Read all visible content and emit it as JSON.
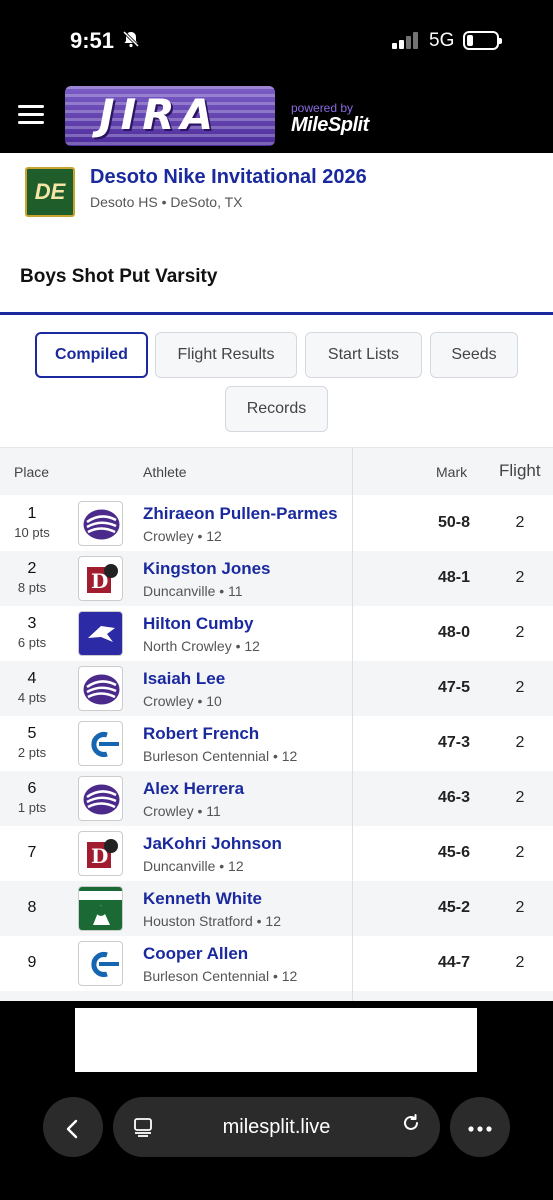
{
  "status_bar": {
    "time": "9:51",
    "network": "5G",
    "bell_icon": "bell-slash-icon"
  },
  "header": {
    "logo_text": "JIRA",
    "powered_by": "powered by",
    "brand": "MileSplit",
    "accent_color": "#5b3bb0"
  },
  "meet": {
    "logo_text": "DE",
    "title": "Desoto Nike Invitational 2026",
    "location": "Desoto HS • DeSoto, TX"
  },
  "event": {
    "title": "Boys Shot Put Varsity"
  },
  "tabs": [
    {
      "label": "Compiled",
      "active": true
    },
    {
      "label": "Flight Results",
      "active": false
    },
    {
      "label": "Start Lists",
      "active": false
    },
    {
      "label": "Seeds",
      "active": false
    },
    {
      "label": "Records",
      "active": false
    }
  ],
  "table": {
    "headers": {
      "place": "Place",
      "athlete": "Athlete",
      "mark": "Mark",
      "flight": "Flight"
    },
    "rows": [
      {
        "place": "1",
        "pts": "10 pts",
        "name": "Zhiraeon Pullen-Parmes",
        "team": "Crowley • 12",
        "logo": "crowley",
        "mark": "50-8",
        "flight": "2"
      },
      {
        "place": "2",
        "pts": "8 pts",
        "name": "Kingston Jones",
        "team": "Duncanville • 11",
        "logo": "duncanville",
        "mark": "48-1",
        "flight": "2"
      },
      {
        "place": "3",
        "pts": "6 pts",
        "name": "Hilton Cumby",
        "team": "North Crowley • 12",
        "logo": "north-crowley",
        "mark": "48-0",
        "flight": "2"
      },
      {
        "place": "4",
        "pts": "4 pts",
        "name": "Isaiah Lee",
        "team": "Crowley • 10",
        "logo": "crowley",
        "mark": "47-5",
        "flight": "2"
      },
      {
        "place": "5",
        "pts": "2 pts",
        "name": "Robert French",
        "team": "Burleson Centennial • 12",
        "logo": "burleson",
        "mark": "47-3",
        "flight": "2"
      },
      {
        "place": "6",
        "pts": "1 pts",
        "name": "Alex Herrera",
        "team": "Crowley • 11",
        "logo": "crowley",
        "mark": "46-3",
        "flight": "2"
      },
      {
        "place": "7",
        "pts": "",
        "name": "JaKohri Johnson",
        "team": "Duncanville • 12",
        "logo": "duncanville",
        "mark": "45-6",
        "flight": "2"
      },
      {
        "place": "8",
        "pts": "",
        "name": "Kenneth White",
        "team": "Houston Stratford • 12",
        "logo": "stratford",
        "mark": "45-2",
        "flight": "2"
      },
      {
        "place": "9",
        "pts": "",
        "name": "Cooper Allen",
        "team": "Burleson Centennial • 12",
        "logo": "burleson",
        "mark": "44-7",
        "flight": "2"
      }
    ]
  },
  "browser": {
    "url": "milesplit.live",
    "back_icon": "chevron-left-icon",
    "reload_icon": "reload-icon",
    "more_icon": "more-icon"
  }
}
